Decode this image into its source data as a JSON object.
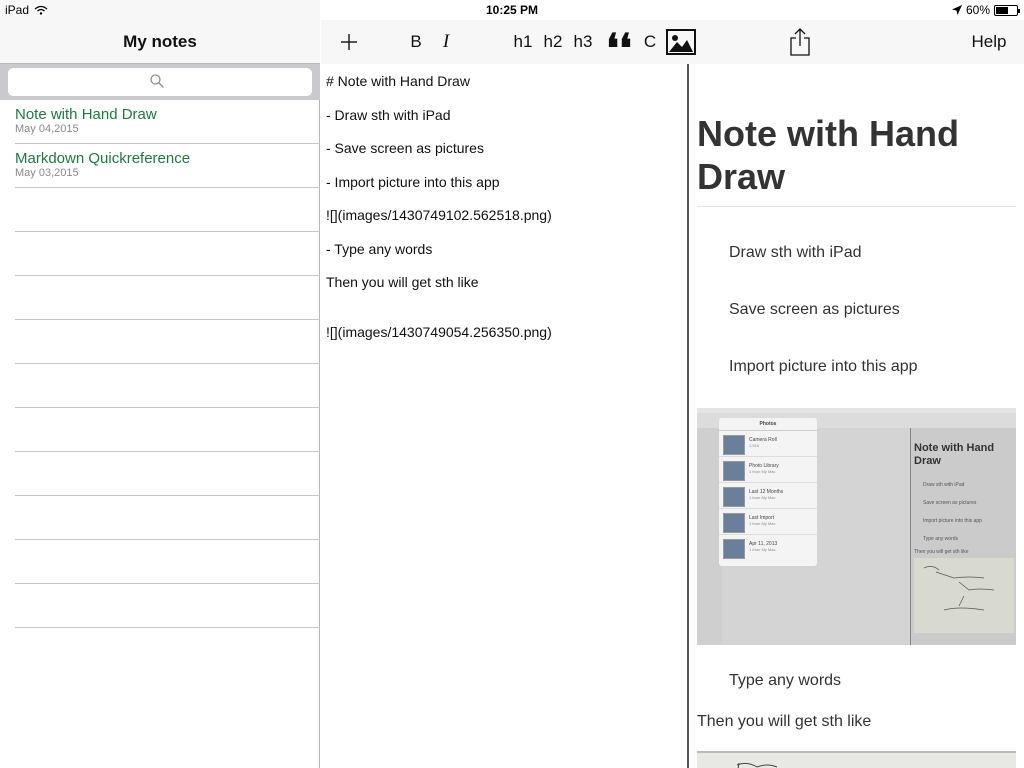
{
  "status_bar": {
    "device": "iPad",
    "time": "10:25 PM",
    "battery_percent": "60%",
    "battery_level": 0.6
  },
  "sidebar": {
    "title": "My notes",
    "search": {
      "placeholder": ""
    },
    "notes": [
      {
        "title": "Note with Hand Draw",
        "date": "May 04,2015"
      },
      {
        "title": "Markdown Quickreference",
        "date": "May 03,2015"
      }
    ]
  },
  "toolbar": {
    "bold_label": "B",
    "italic_label": "I",
    "h1_label": "h1",
    "h2_label": "h2",
    "h3_label": "h3",
    "quote_label": "❛❛",
    "code_label": "C",
    "help_label": "Help",
    "icons": [
      "plus-icon",
      "image-icon",
      "share-icon"
    ]
  },
  "editor": {
    "lines": [
      "# Note with Hand Draw",
      "- Draw sth with iPad",
      "- Save screen as pictures",
      "- Import picture into this app",
      "![](images/1430749102.562518.png)",
      "- Type any words",
      "Then you will get sth like",
      "![](images/1430749054.256350.png)"
    ]
  },
  "preview": {
    "heading": "Note with Hand Draw",
    "items": [
      "Draw sth with iPad",
      "Save screen as pictures",
      "Import picture into this app"
    ],
    "item_after_image": "Type any words",
    "paragraph": "Then you will get sth like",
    "embedded_screenshot": {
      "photos_title": "Photos",
      "albums": [
        {
          "name": "Camera Roll",
          "count": "1,516"
        },
        {
          "name": "Photo Library",
          "count": "1 from My Mac"
        },
        {
          "name": "Last 12 Months",
          "count": "1 from My Mac"
        },
        {
          "name": "Last Import",
          "count": "1 from My Mac"
        },
        {
          "name": "Apr 11, 2013",
          "count": "1 from My Mac"
        }
      ],
      "heading": "Note with Hand Draw",
      "items": [
        "Draw sth with iPad",
        "Save screen as pictures",
        "Import picture into this app",
        "Type any words",
        "Then you will get sth like"
      ]
    }
  },
  "colors": {
    "note_title": "#1f7a3e",
    "toolbar_bg": "#f7f7f7",
    "search_bg": "#c9c9ce"
  }
}
